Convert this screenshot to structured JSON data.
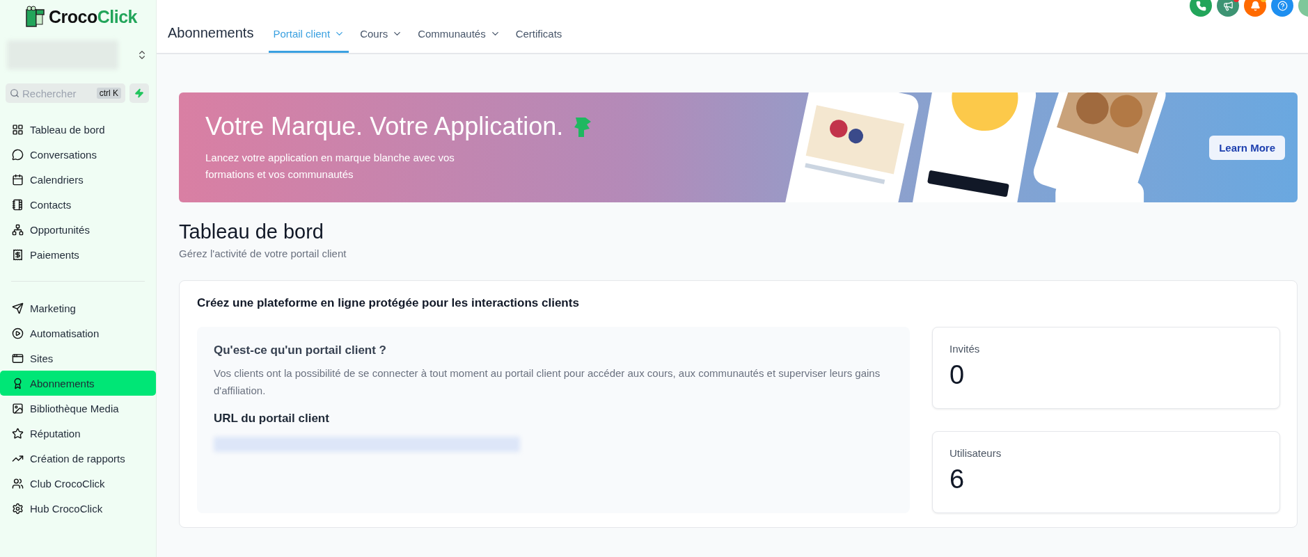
{
  "brand": {
    "first": "Croco",
    "second": "Click"
  },
  "search": {
    "placeholder": "Rechercher",
    "shortcut": "ctrl K"
  },
  "sidebar": {
    "groups": [
      [
        {
          "label": "Tableau de bord",
          "selected": false
        },
        {
          "label": "Conversations",
          "selected": false
        },
        {
          "label": "Calendriers",
          "selected": false
        },
        {
          "label": "Contacts",
          "selected": false
        },
        {
          "label": "Opportunités",
          "selected": false
        },
        {
          "label": "Paiements",
          "selected": false
        }
      ],
      [
        {
          "label": "Marketing",
          "selected": false
        },
        {
          "label": "Automatisation",
          "selected": false
        },
        {
          "label": "Sites",
          "selected": false
        },
        {
          "label": "Abonnements",
          "selected": true
        },
        {
          "label": "Bibliothèque Media",
          "selected": false
        },
        {
          "label": "Réputation",
          "selected": false
        },
        {
          "label": "Création de rapports",
          "selected": false
        },
        {
          "label": "Club CrocoClick",
          "selected": false
        },
        {
          "label": "Hub CrocoClick",
          "selected": false
        }
      ]
    ]
  },
  "header": {
    "title": "Abonnements",
    "tabs": [
      {
        "label": "Portail client",
        "dropdown": true,
        "selected": true
      },
      {
        "label": "Cours",
        "dropdown": true,
        "selected": false
      },
      {
        "label": "Communautés",
        "dropdown": true,
        "selected": false
      },
      {
        "label": "Certificats",
        "dropdown": false,
        "selected": false
      }
    ]
  },
  "banner": {
    "title": "Votre Marque. Votre Application.",
    "text": "Lancez votre application en marque blanche avec vos formations et vos communautés",
    "button": "Learn More"
  },
  "page": {
    "title": "Tableau de bord",
    "subtitle": "Gérez l'activité de votre portail client"
  },
  "card": {
    "title": "Créez une plateforme en ligne protégée pour les interactions clients",
    "info": {
      "heading": "Qu'est-ce qu'un portail client ?",
      "text": "Vos clients ont la possibilité de se connecter à tout moment au portail client pour accéder aux cours, aux communautés et superviser leurs gains d'affiliation.",
      "url_heading": "URL du portail client"
    },
    "stats": [
      {
        "label": "Invités",
        "value": "0"
      },
      {
        "label": "Utilisateurs",
        "value": "6"
      }
    ]
  }
}
